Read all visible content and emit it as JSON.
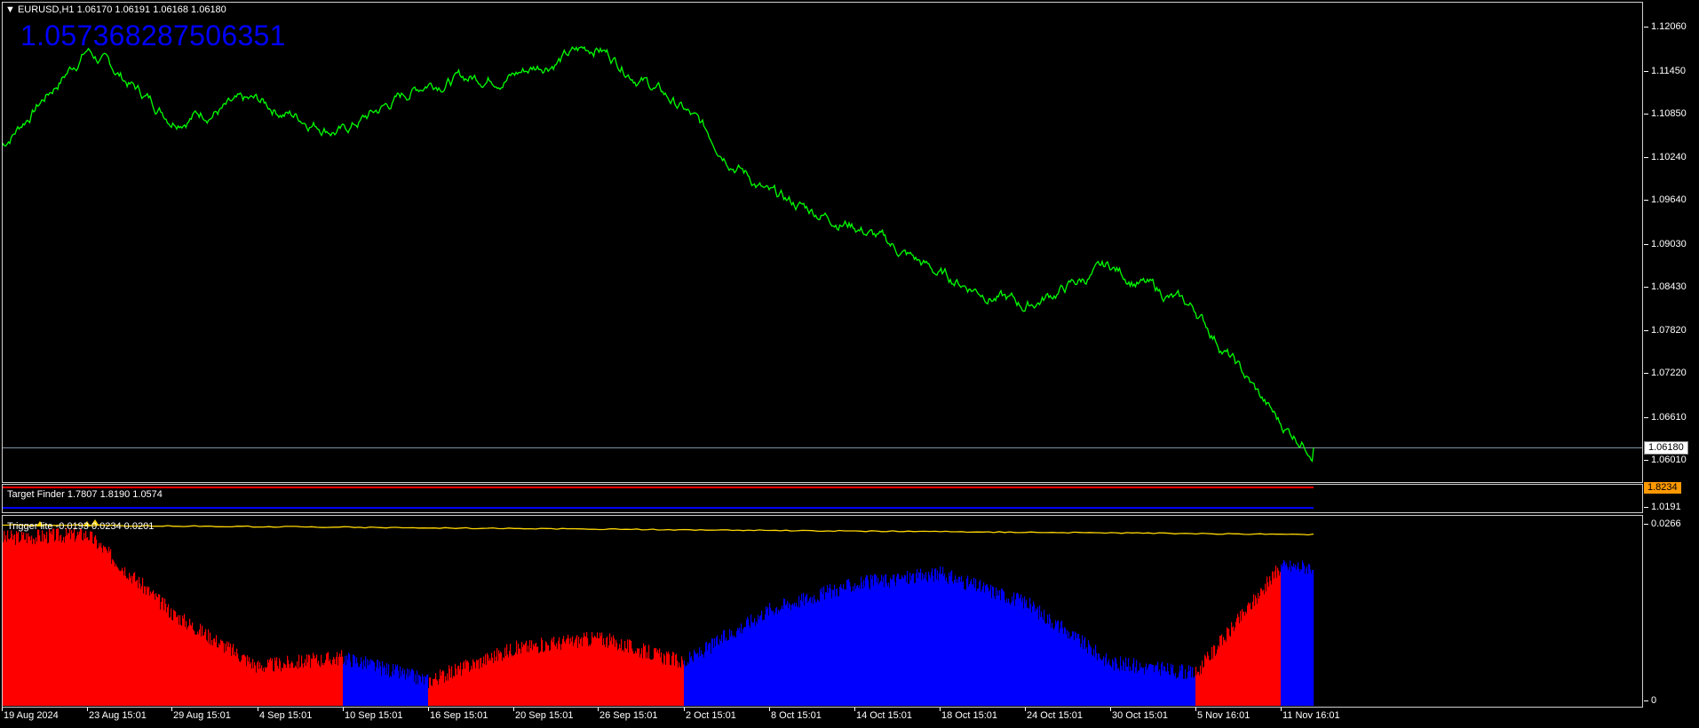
{
  "symbol_title": "EURUSD,H1  1.06170 1.06191 1.06168 1.06180",
  "big_price": "1.05736828750635​1",
  "main_price_scale": [
    "1.12060",
    "1.11450",
    "1.10850",
    "1.10240",
    "1.09640",
    "1.09030",
    "1.08430",
    "1.07820",
    "1.07220",
    "1.06610",
    "1.06010"
  ],
  "current_price": "1.06180",
  "target_finder": {
    "title": "Target Finder 1.7807 1.8190 1.0574",
    "scale_value": "1.8234",
    "scale_low": "1.0191",
    "colors": {
      "red": "#ff0000",
      "blue": "#0000ff",
      "orange": "#ff9900"
    }
  },
  "trigger": {
    "title": "Trigger lite -0.0193 0.0234 0.0201",
    "scale_top": "0.0266",
    "scale_bottom": "0",
    "colors": {
      "red": "#ff0000",
      "blue": "#0000ff",
      "yellow": "#ffd700"
    }
  },
  "x_axis_labels": [
    "19 Aug 2024",
    "23 Aug 15:01",
    "29 Aug 15:01",
    "4 Sep 15:01",
    "10 Sep 15:01",
    "16 Sep 15:01",
    "20 Sep 15:01",
    "26 Sep 15:01",
    "2 Oct 15:01",
    "8 Oct 15:01",
    "14 Oct 15:01",
    "18 Oct 15:01",
    "24 Oct 15:01",
    "30 Oct 15:01",
    "5 Nov 16:01",
    "11 Nov 16:01"
  ],
  "chart_data": {
    "type": "line",
    "title": "EURUSD,H1",
    "series": [
      {
        "color": "#00ff00",
        "x": [
          "19 Aug 2024",
          "23 Aug 15:01",
          "29 Aug 15:01",
          "4 Sep 15:01",
          "10 Sep 15:01",
          "16 Sep 15:01",
          "20 Sep 15:01",
          "26 Sep 15:01",
          "2 Oct 15:01",
          "8 Oct 15:01",
          "14 Oct 15:01",
          "18 Oct 15:01",
          "24 Oct 15:01",
          "30 Oct 15:01",
          "5 Nov 16:01",
          "11 Nov 16:01"
        ],
        "values": [
          1.104,
          1.1175,
          1.108,
          1.11,
          1.106,
          1.113,
          1.114,
          1.118,
          1.109,
          1.097,
          1.093,
          1.086,
          1.0815,
          1.087,
          1.081,
          1.065
        ]
      }
    ],
    "extra_points": {
      "end_value": 1.0618
    },
    "ylim": [
      1.057,
      1.124
    ],
    "y_ticks": [
      "1.12060",
      "1.11450",
      "1.10850",
      "1.10240",
      "1.09640",
      "1.09030",
      "1.08430",
      "1.07820",
      "1.07220",
      "1.06610",
      "1.06010"
    ],
    "grid": false,
    "histogram": {
      "name": "Trigger lite",
      "ylim": [
        0,
        0.0266
      ],
      "x": [
        "19 Aug 2024",
        "23 Aug 15:01",
        "29 Aug 15:01",
        "4 Sep 15:01",
        "10 Sep 15:01",
        "16 Sep 15:01",
        "20 Sep 15:01",
        "26 Sep 15:01",
        "2 Oct 15:01",
        "8 Oct 15:01",
        "14 Oct 15:01",
        "18 Oct 15:01",
        "24 Oct 15:01",
        "30 Oct 15:01",
        "5 Nov 16:01",
        "11 Nov 16:01"
      ],
      "values": [
        0.0235,
        0.024,
        0.013,
        0.0055,
        0.0068,
        0.0035,
        0.008,
        0.0095,
        0.006,
        0.0135,
        0.017,
        0.0185,
        0.0145,
        0.006,
        0.0045,
        0.0195
      ],
      "colors": [
        "red",
        "red",
        "red",
        "red",
        "blue",
        "red",
        "red",
        "red",
        "blue",
        "blue",
        "blue",
        "blue",
        "blue",
        "blue",
        "red",
        "blue"
      ]
    }
  }
}
